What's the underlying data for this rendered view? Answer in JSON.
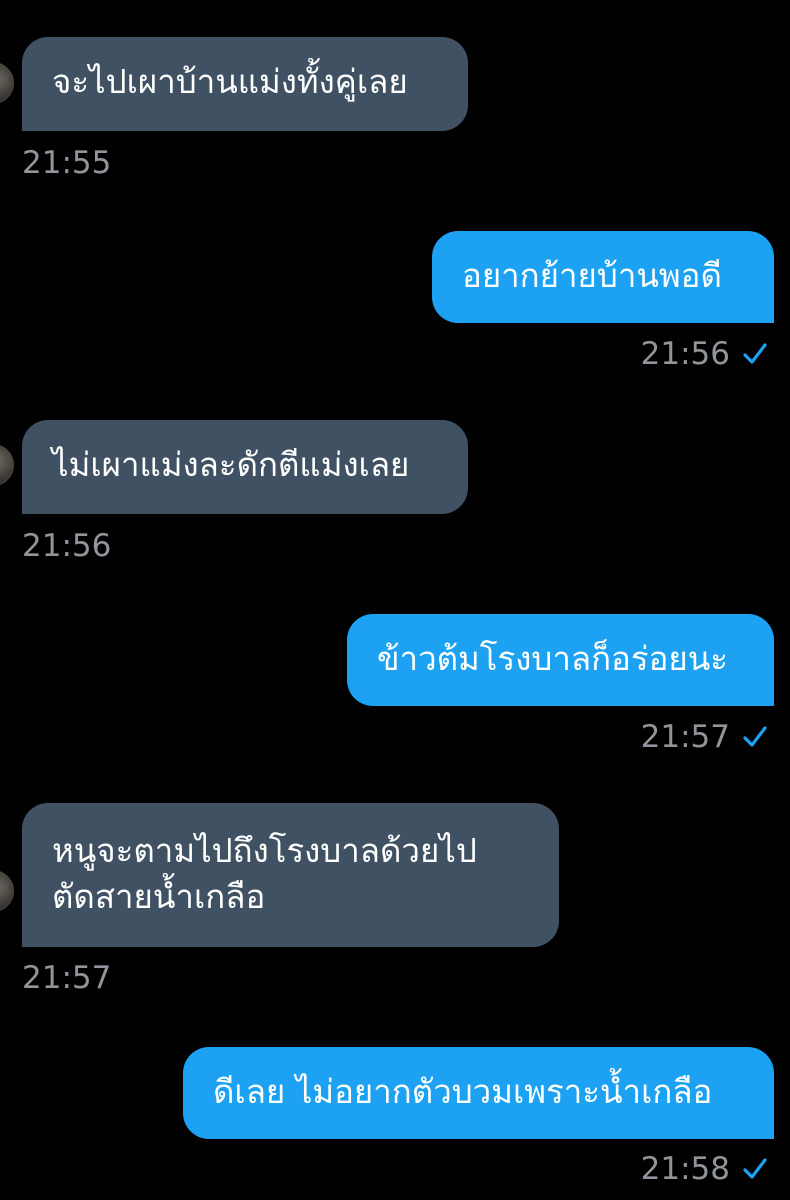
{
  "messages": [
    {
      "direction": "incoming",
      "text": "จะไปเผาบ้านแม่งทั้งคู่เลย",
      "time": "21:55"
    },
    {
      "direction": "outgoing",
      "text": "อยากย้ายบ้านพอดี",
      "time": "21:56",
      "status": "sent"
    },
    {
      "direction": "incoming",
      "text": "ไม่เผาแม่งละดักตีแม่งเลย",
      "time": "21:56"
    },
    {
      "direction": "outgoing",
      "text": "ข้าวต้มโรงบาลก็อร่อยนะ",
      "time": "21:57",
      "status": "sent"
    },
    {
      "direction": "incoming",
      "text_lines": [
        "หนูจะตามไปถึงโรงบาลด้วยไป",
        "ตัดสายน้ำเกลือ"
      ],
      "time": "21:57"
    },
    {
      "direction": "outgoing",
      "text": "ดีเลย ไม่อยากตัวบวมเพราะน้ำเกลือ",
      "time": "21:58",
      "status": "sent"
    }
  ],
  "colors": {
    "background": "#000000",
    "incoming_bubble": "#3f5163",
    "outgoing_bubble": "#1da1f2",
    "timestamp": "#8f959b",
    "check": "#1da1f2"
  },
  "icons": {
    "sent_status": "check-icon",
    "sender_avatar": "avatar"
  }
}
